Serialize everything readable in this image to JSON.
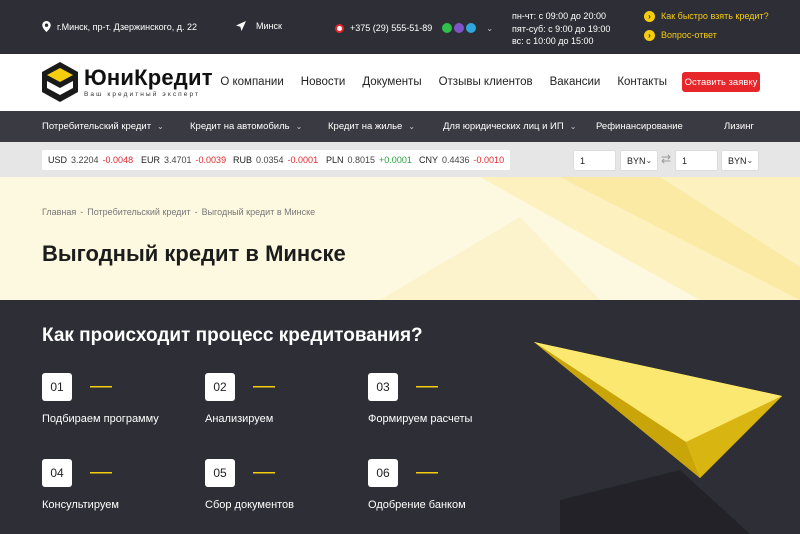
{
  "topbar": {
    "address": "г.Минск, пр-т. Дзержинского, д. 22",
    "city": "Минск",
    "phone": "+375 (29) 555-51-89",
    "hours": [
      "пн-чт: с 09:00 до 20:00",
      "пят-суб: с 9:00 до 19:00",
      "вс: с 10:00 до 15:00"
    ],
    "links": [
      "Как быстро взять кредит?",
      "Вопрос-ответ"
    ],
    "accent": "#f5cd0f"
  },
  "header": {
    "logo_title": "ЮниКредит",
    "logo_sub": "Ваш кредитный эксперт",
    "nav": [
      "О компании",
      "Новости",
      "Документы",
      "Отзывы клиентов",
      "Вакансии",
      "Контакты"
    ],
    "cta": "Оставить заявку",
    "cta_color": "#e6262b"
  },
  "categories": [
    "Потребительский кредит",
    "Кредит на автомобиль",
    "Кредит на жилье",
    "Для юридических лиц и ИП",
    "Рефинансирование",
    "Лизинг"
  ],
  "rates": [
    {
      "code": "USD",
      "value": "3.2204",
      "change": "-0.0048"
    },
    {
      "code": "EUR",
      "value": "3.4701",
      "change": "-0.0039"
    },
    {
      "code": "RUB",
      "value": "0.0354",
      "change": "-0.0001"
    },
    {
      "code": "PLN",
      "value": "0.8015",
      "change": "+0.0001"
    },
    {
      "code": "CNY",
      "value": "0.4436",
      "change": "-0.0010"
    }
  ],
  "converter": {
    "amount_from": "1",
    "currency_from": "BYN",
    "amount_to": "1",
    "currency_to": "BYN"
  },
  "hero": {
    "breadcrumbs": [
      "Главная",
      "Потребительский кредит",
      "Выгодный кредит в Минске"
    ],
    "title": "Выгодный кредит в Минске"
  },
  "process": {
    "title": "Как происходит процесс кредитования?",
    "steps": [
      {
        "num": "01",
        "label": "Подбираем программу"
      },
      {
        "num": "02",
        "label": "Анализируем"
      },
      {
        "num": "03",
        "label": "Формируем расчеты"
      },
      {
        "num": "04",
        "label": "Консультируем"
      },
      {
        "num": "05",
        "label": "Сбор документов"
      },
      {
        "num": "06",
        "label": "Одобрение банком"
      }
    ]
  }
}
